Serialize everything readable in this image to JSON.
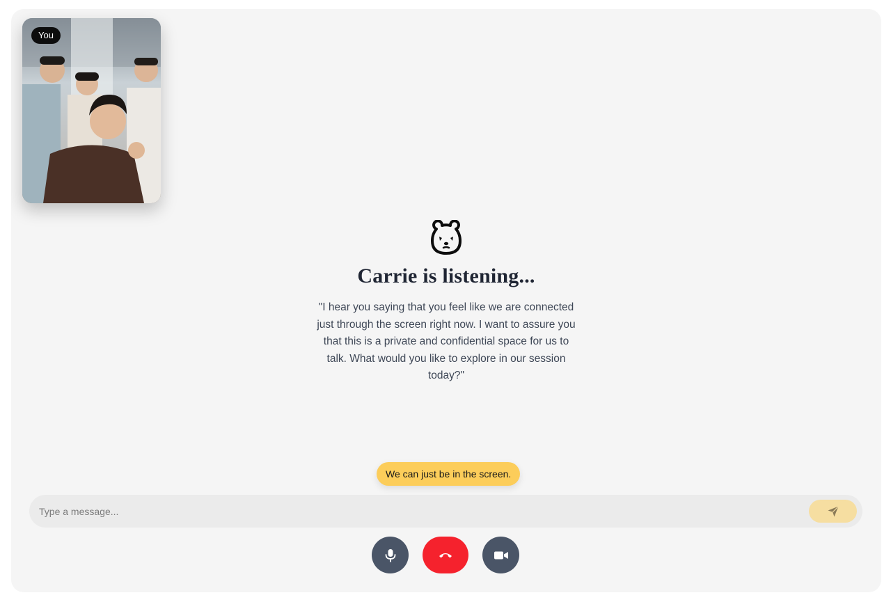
{
  "self_video": {
    "badge_label": "You"
  },
  "assistant": {
    "icon": "bear-icon",
    "title": "Carrie is listening...",
    "quote": "\"I hear you saying that you feel like we are connected just through the screen right now. I want to assure you that this is a private and confidential space for us to talk. What would you like to explore in our session today?\""
  },
  "suggestion": {
    "label": "We can just be in the screen."
  },
  "message_bar": {
    "placeholder": "Type a message...",
    "value": "",
    "send_icon": "send-icon"
  },
  "controls": {
    "mic_icon": "microphone-icon",
    "end_icon": "end-call-icon",
    "camera_icon": "video-camera-icon"
  },
  "colors": {
    "background": "#f5f5f5",
    "chip": "#fccd5a",
    "send_button": "#f6dea1",
    "control": "#4a5567",
    "end_call": "#f5222d"
  }
}
